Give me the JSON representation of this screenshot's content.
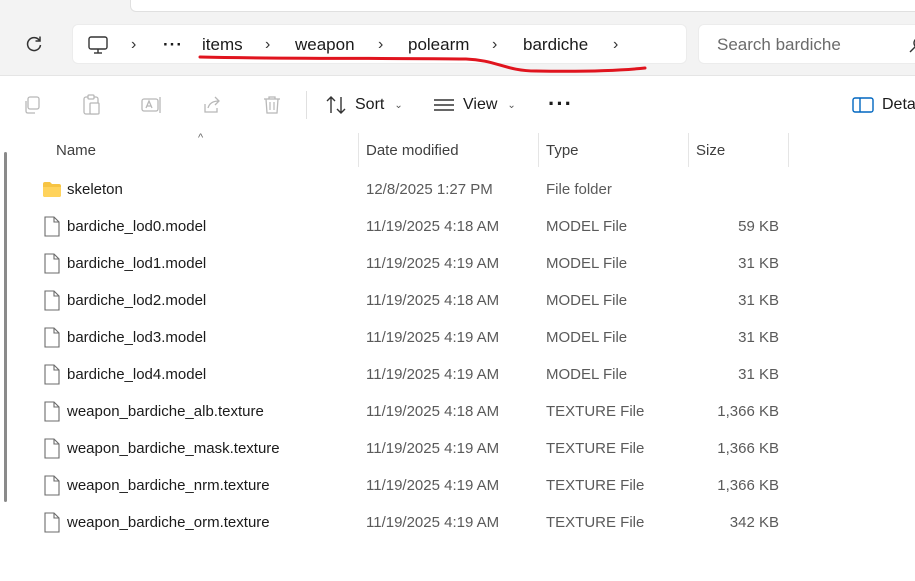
{
  "breadcrumb": {
    "more": "···",
    "items": [
      "items",
      "weapon",
      "polearm",
      "bardiche"
    ]
  },
  "search": {
    "placeholder": "Search bardiche"
  },
  "toolbar": {
    "sort_label": "Sort",
    "view_label": "View",
    "more_label": "···",
    "details_label": "Details"
  },
  "columns": {
    "name": "Name",
    "date": "Date modified",
    "type": "Type",
    "size": "Size"
  },
  "files": [
    {
      "name": "skeleton",
      "date": "12/8/2025 1:27 PM",
      "type": "File folder",
      "size": "",
      "kind": "folder"
    },
    {
      "name": "bardiche_lod0.model",
      "date": "11/19/2025 4:18 AM",
      "type": "MODEL File",
      "size": "59 KB",
      "kind": "file"
    },
    {
      "name": "bardiche_lod1.model",
      "date": "11/19/2025 4:19 AM",
      "type": "MODEL File",
      "size": "31 KB",
      "kind": "file"
    },
    {
      "name": "bardiche_lod2.model",
      "date": "11/19/2025 4:18 AM",
      "type": "MODEL File",
      "size": "31 KB",
      "kind": "file"
    },
    {
      "name": "bardiche_lod3.model",
      "date": "11/19/2025 4:19 AM",
      "type": "MODEL File",
      "size": "31 KB",
      "kind": "file"
    },
    {
      "name": "bardiche_lod4.model",
      "date": "11/19/2025 4:19 AM",
      "type": "MODEL File",
      "size": "31 KB",
      "kind": "file"
    },
    {
      "name": "weapon_bardiche_alb.texture",
      "date": "11/19/2025 4:18 AM",
      "type": "TEXTURE File",
      "size": "1,366 KB",
      "kind": "file"
    },
    {
      "name": "weapon_bardiche_mask.texture",
      "date": "11/19/2025 4:19 AM",
      "type": "TEXTURE File",
      "size": "1,366 KB",
      "kind": "file"
    },
    {
      "name": "weapon_bardiche_nrm.texture",
      "date": "11/19/2025 4:19 AM",
      "type": "TEXTURE File",
      "size": "1,366 KB",
      "kind": "file"
    },
    {
      "name": "weapon_bardiche_orm.texture",
      "date": "11/19/2025 4:19 AM",
      "type": "TEXTURE File",
      "size": "342 KB",
      "kind": "file"
    }
  ],
  "colors": {
    "annotation_underline": "#e0141e",
    "folder": "#f7c443",
    "accent": "#0067c0"
  }
}
